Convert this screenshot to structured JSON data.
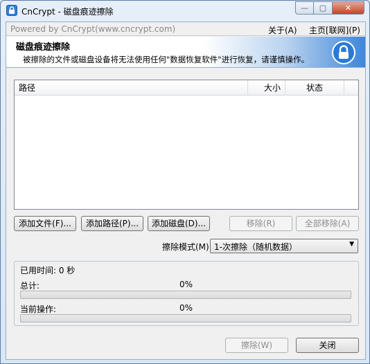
{
  "window": {
    "title": "CnCrypt - 磁盘痕迹擦除",
    "min_glyph": "—",
    "max_glyph": "▢",
    "close_glyph": "✕"
  },
  "menubar": {
    "powered_by": "Powered by CnCrypt(www.cncrypt.com)",
    "about": "关于(A)",
    "home": "主页[联网](P)"
  },
  "banner": {
    "title": "磁盘痕迹擦除",
    "description": "被擦除的文件或磁盘设备将无法使用任何\"数据恢复软件\"进行恢复，请谨慎操作。",
    "icon": "lock-icon"
  },
  "file_list": {
    "columns": [
      "路径",
      "大小",
      "状态"
    ],
    "rows": []
  },
  "buttons": {
    "add_file": "添加文件(F)...",
    "add_path": "添加路径(P)...",
    "add_disk": "添加磁盘(D)...",
    "remove": "移除(R)",
    "remove_all": "全部移除(A)",
    "erase": "擦除(W)",
    "close": "关闭"
  },
  "erase_mode": {
    "label": "擦除模式(M)",
    "selected": "1-次擦除（随机数据）"
  },
  "progress": {
    "elapsed": "已用时间: 0 秒",
    "total_label": "总计:",
    "total_percent": "0%",
    "total_value": 0,
    "current_label": "当前操作:",
    "current_percent": "0%",
    "current_value": 0
  }
}
